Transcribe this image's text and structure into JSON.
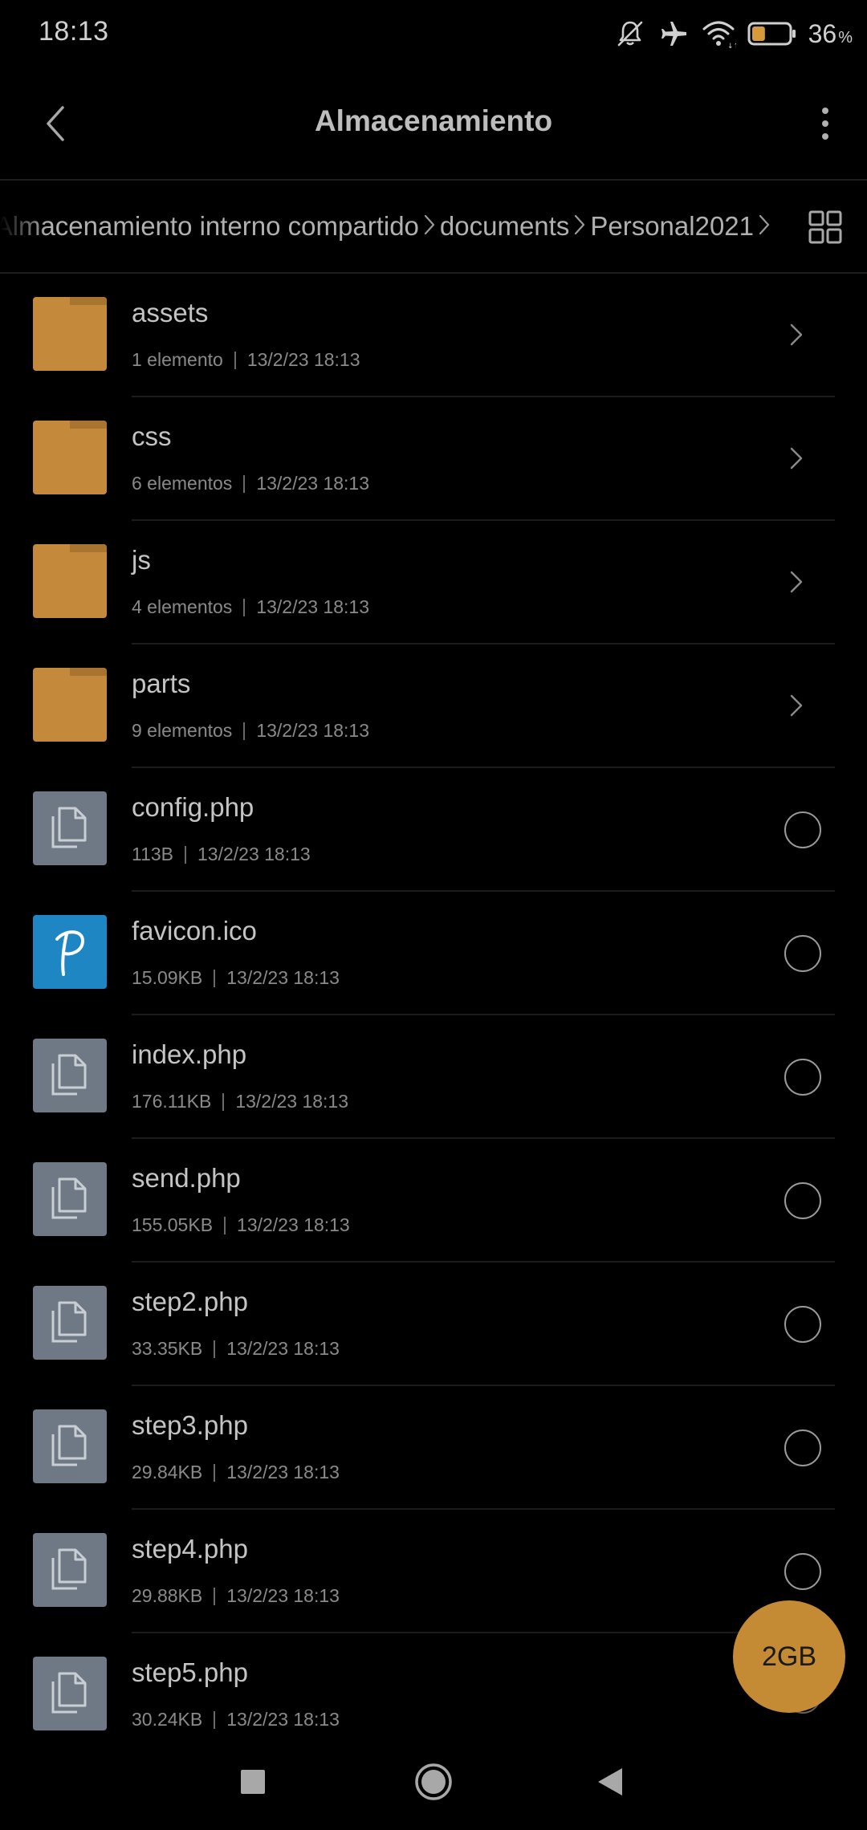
{
  "status_bar": {
    "time": "18:13",
    "battery_percent": "36",
    "battery_unit": "%",
    "battery_level": 0.36,
    "icons": [
      "mute-icon",
      "airplane-icon",
      "wifi-icon",
      "battery-icon"
    ]
  },
  "header": {
    "title": "Almacenamiento",
    "back_icon": "chevron-left-icon",
    "menu_icon": "more-vertical-icon"
  },
  "breadcrumb": {
    "items": [
      "Almacenamiento interno compartido",
      "documents",
      "Personal2021"
    ],
    "view_toggle_icon": "grid-view-icon"
  },
  "files": [
    {
      "name": "assets",
      "type": "folder",
      "info": "1 elemento",
      "date": "13/2/23 18:13"
    },
    {
      "name": "css",
      "type": "folder",
      "info": "6 elementos",
      "date": "13/2/23 18:13"
    },
    {
      "name": "js",
      "type": "folder",
      "info": "4 elementos",
      "date": "13/2/23 18:13"
    },
    {
      "name": "parts",
      "type": "folder",
      "info": "9 elementos",
      "date": "13/2/23 18:13"
    },
    {
      "name": "config.php",
      "type": "file",
      "info": "113B",
      "date": "13/2/23 18:13"
    },
    {
      "name": "favicon.ico",
      "type": "image",
      "info": "15.09KB",
      "date": "13/2/23 18:13"
    },
    {
      "name": "index.php",
      "type": "file",
      "info": "176.11KB",
      "date": "13/2/23 18:13"
    },
    {
      "name": "send.php",
      "type": "file",
      "info": "155.05KB",
      "date": "13/2/23 18:13"
    },
    {
      "name": "step2.php",
      "type": "file",
      "info": "33.35KB",
      "date": "13/2/23 18:13"
    },
    {
      "name": "step3.php",
      "type": "file",
      "info": "29.84KB",
      "date": "13/2/23 18:13"
    },
    {
      "name": "step4.php",
      "type": "file",
      "info": "29.88KB",
      "date": "13/2/23 18:13"
    },
    {
      "name": "step5.php",
      "type": "file",
      "info": "30.24KB",
      "date": "13/2/23 18:13"
    }
  ],
  "storage_fab": {
    "label": "2GB"
  },
  "colors": {
    "folder": "#c4893a",
    "doc": "#6f7985",
    "ico": "#1d86c3",
    "fab": "#c48a34",
    "battery_fill": "#d79a3a"
  },
  "nav_bar": {
    "icons": [
      "recents-square-icon",
      "home-circle-icon",
      "back-triangle-icon"
    ]
  }
}
